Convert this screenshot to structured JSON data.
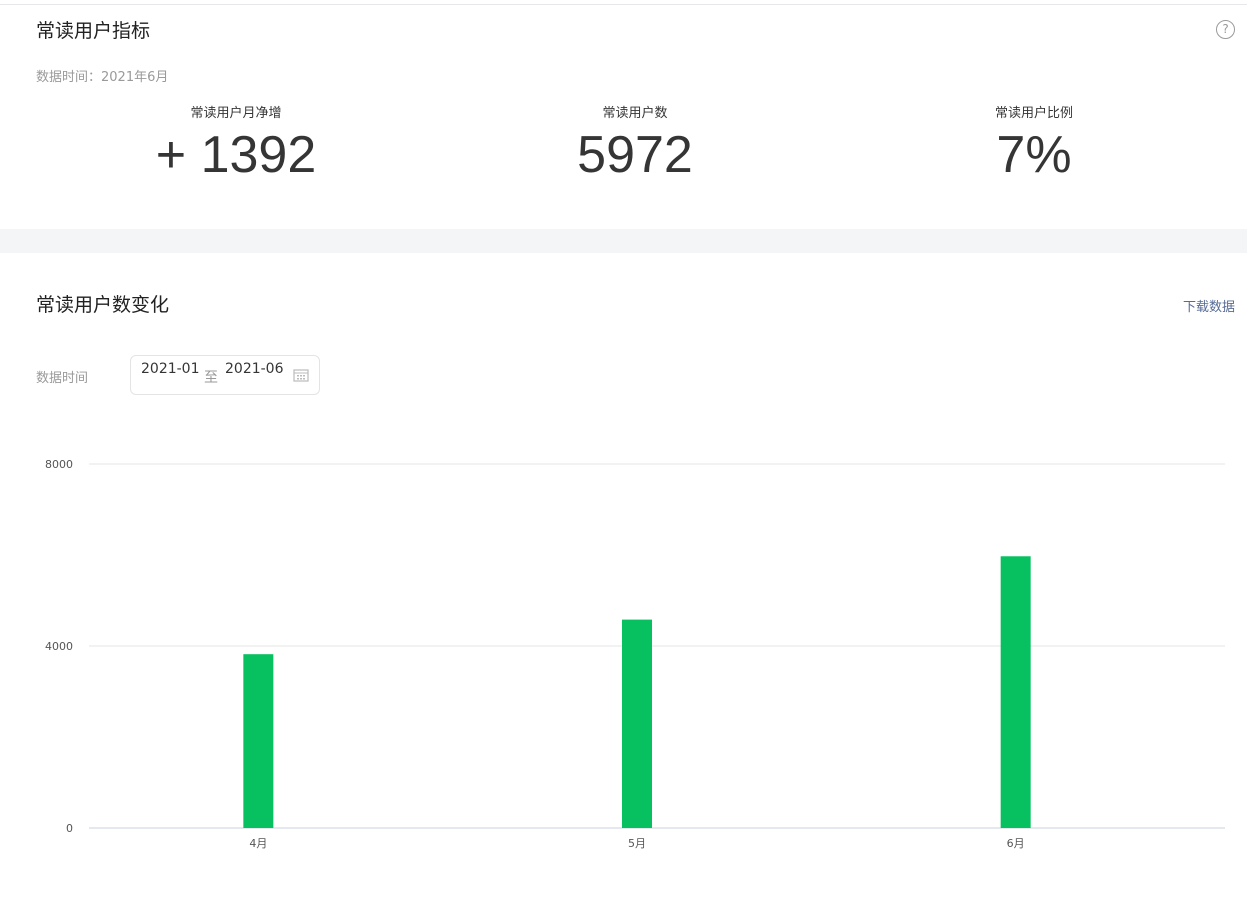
{
  "indicators": {
    "title": "常读用户指标",
    "help_icon": "?",
    "data_time": "数据时间：2021年6月",
    "metrics": [
      {
        "label": "常读用户月净增",
        "value": "+ 1392"
      },
      {
        "label": "常读用户数",
        "value": "5972"
      },
      {
        "label": "常读用户比例",
        "value": "7%"
      }
    ]
  },
  "trend": {
    "title": "常读用户数变化",
    "download": "下载数据",
    "date_label": "数据时间",
    "start": "2021-01",
    "separator": "至",
    "end": "2021-06"
  },
  "chart_data": {
    "type": "bar",
    "categories": [
      "4月",
      "5月",
      "6月"
    ],
    "values": [
      3820,
      4580,
      5972
    ],
    "yticks": [
      "0",
      "4000",
      "8000"
    ],
    "ylim": [
      0,
      8000
    ],
    "grid": true,
    "color": "#07c160"
  }
}
